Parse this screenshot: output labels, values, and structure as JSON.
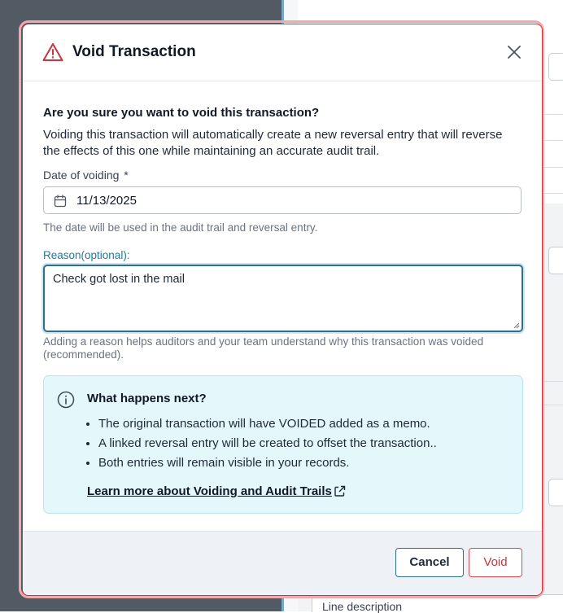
{
  "background": {
    "line_description_label": "Line description"
  },
  "modal": {
    "title": "Void Transaction",
    "question": "Are you sure you want to void this transaction?",
    "description": "Voiding this transaction will automatically create a new reversal entry that will reverse the effects of this one while maintaining an accurate audit trail.",
    "date_label": "Date of voiding",
    "date_required_mark": "*",
    "date_value": "11/13/2025",
    "date_help": "The date will be used in the audit trail and reversal entry.",
    "reason_label": "Reason(optional):",
    "reason_value": "Check got lost in the mail",
    "reason_help": "Adding a reason helps auditors and your team understand why this transaction was voided (recommended).",
    "info": {
      "title": "What happens next?",
      "items": [
        "The original transaction will have VOIDED added as a memo.",
        "A linked reversal entry will be created to offset the transaction..",
        "Both entries will remain visible in your records."
      ],
      "link_text": "Learn more about Voiding and Audit Trails"
    },
    "buttons": {
      "cancel": "Cancel",
      "void": "Void"
    }
  },
  "colors": {
    "danger": "#c9343d",
    "primary_border": "#2c6f8f",
    "info_bg": "#e4f7fa",
    "footer_bg": "#eef2f6"
  }
}
